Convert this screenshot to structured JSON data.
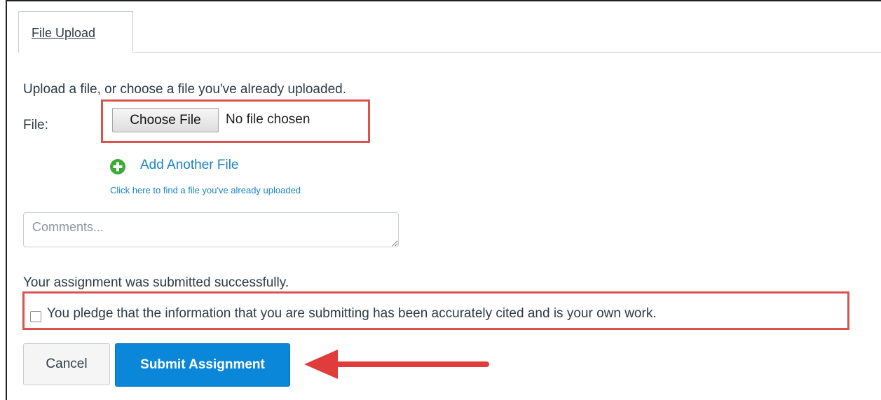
{
  "tabs": [
    {
      "label": "File Upload"
    }
  ],
  "upload": {
    "instructions": "Upload a file, or choose a file you've already uploaded.",
    "file_label": "File:",
    "choose_button": "Choose File",
    "file_status": "No file chosen",
    "add_another": "Add Another File",
    "find_existing": "Click here to find a file you've already uploaded"
  },
  "comments": {
    "placeholder": "Comments...",
    "value": ""
  },
  "status": {
    "message": "Your assignment was submitted successfully."
  },
  "pledge": {
    "checked": false,
    "text": "You pledge that the information that you are submitting has been accurately cited and is your own work."
  },
  "actions": {
    "cancel": "Cancel",
    "submit": "Submit Assignment"
  },
  "icons": {
    "add": "plus-circle-icon",
    "annotation": "arrow-left-icon"
  },
  "colors": {
    "accent": "#0a87d8",
    "link": "#1a84c6",
    "add_icon": "#3aa935",
    "highlight": "#d9534f",
    "text": "#2d3b45"
  }
}
